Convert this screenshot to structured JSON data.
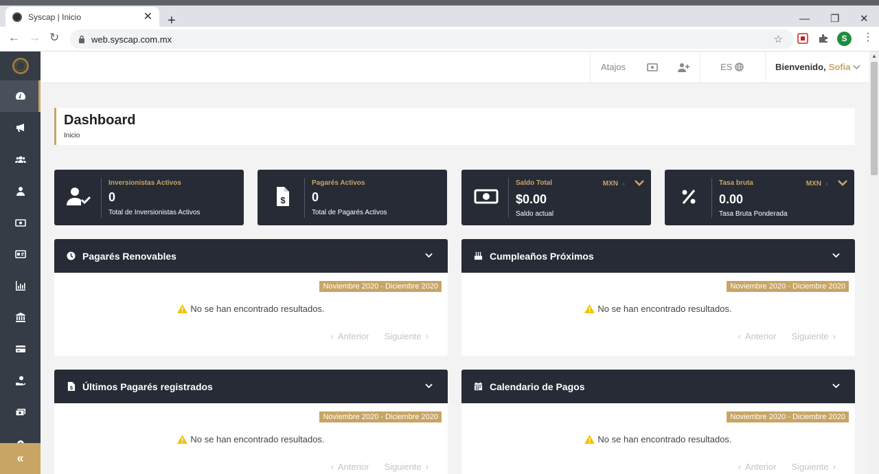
{
  "browser": {
    "tab_title": "Syscap | Inicio",
    "url": "web.syscap.com.mx",
    "profile_initial": "S"
  },
  "header": {
    "shortcuts_label": "Atajos",
    "language": "ES",
    "welcome_label": "Bienvenido,",
    "user_name": "Sofia"
  },
  "page": {
    "title": "Dashboard",
    "breadcrumb": "Inicio"
  },
  "stats": [
    {
      "label": "Inversionistas Activos",
      "value": "0",
      "sub": "Total de Inversionistas Activos",
      "icon": "user-check-icon"
    },
    {
      "label": "Pagarés Activos",
      "value": "0",
      "sub": "Total de Pagarés Activos",
      "icon": "file-dollar-icon"
    },
    {
      "label": "Saldo Total",
      "value": "$0.00",
      "sub": "Saldo actual",
      "currency": "MXN",
      "icon": "money-bill-icon"
    },
    {
      "label": "Tasa bruta",
      "value": "0.00",
      "sub": "Tasa Bruta Ponderada",
      "currency": "MXN",
      "icon": "percent-icon"
    }
  ],
  "panels": [
    {
      "title": "Pagarés Renovables",
      "icon": "clock-icon",
      "range": "Noviembre 2020 - Diciembre 2020",
      "empty": "No se han encontrado resultados.",
      "prev": "Anterior",
      "next": "Siguiente"
    },
    {
      "title": "Cumpleaños Próximos",
      "icon": "birthday-cake-icon",
      "range": "Noviembre 2020 - Diciembre 2020",
      "empty": "No se han encontrado resultados.",
      "prev": "Anterior",
      "next": "Siguiente"
    },
    {
      "title": "Últimos Pagarés registrados",
      "icon": "file-dollar-icon",
      "range": "Noviembre 2020 - Diciembre 2020",
      "empty": "No se han encontrado resultados.",
      "prev": "Anterior",
      "next": "Siguiente"
    },
    {
      "title": "Calendario de Pagos",
      "icon": "calendar-icon",
      "range": "Noviembre 2020 - Diciembre 2020",
      "empty": "No se han encontrado resultados.",
      "prev": "Anterior",
      "next": "Siguiente"
    }
  ],
  "colors": {
    "accent": "#c8a565",
    "dark": "#262b35",
    "sidebar": "#363c46"
  }
}
